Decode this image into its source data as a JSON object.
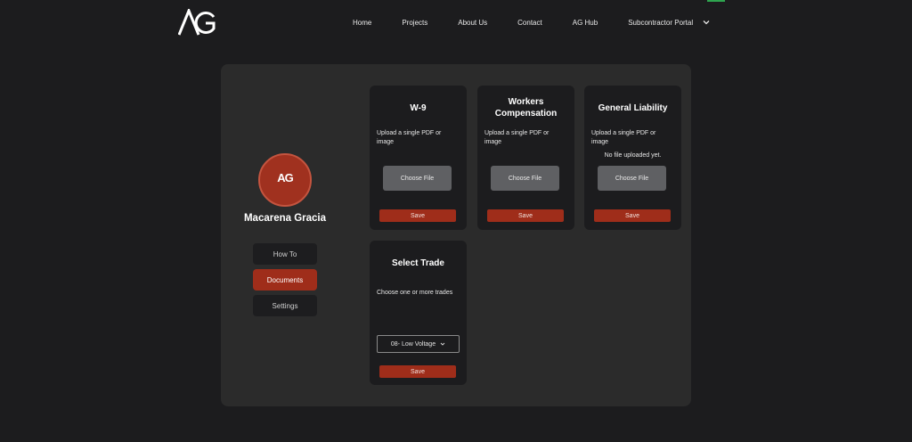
{
  "header": {
    "logo_text": "AG",
    "nav": [
      {
        "label": "Home"
      },
      {
        "label": "Projects"
      },
      {
        "label": "About Us"
      },
      {
        "label": "Contact"
      },
      {
        "label": "AG Hub"
      },
      {
        "label": "Subcontractor Portal"
      }
    ],
    "dropdown_icon": "chevron-down-icon"
  },
  "profile": {
    "avatar_text": "AG",
    "name": "Macarena Gracia",
    "menu": [
      {
        "label": "How To",
        "active": false
      },
      {
        "label": "Documents",
        "active": true
      },
      {
        "label": "Settings",
        "active": false
      }
    ]
  },
  "cards": {
    "w9": {
      "title": "W-9",
      "hint": "Upload a single PDF or image",
      "file_button": "Choose File",
      "save": "Save"
    },
    "workers_comp": {
      "title_line1": "Workers",
      "title_line2": "Compensation",
      "hint": "Upload a single PDF or image",
      "file_button": "Choose File",
      "save": "Save"
    },
    "general_liability": {
      "title": "General Liability",
      "hint": "Upload a single PDF or image",
      "status": "No file uploaded yet.",
      "file_button": "Choose File",
      "save": "Save"
    },
    "select_trade": {
      "title": "Select Trade",
      "hint": "Choose one or more trades",
      "selected": "08- Low Voltage",
      "save": "Save"
    }
  },
  "colors": {
    "background": "#1c1c1e",
    "panel": "#2b2b2b",
    "accent": "#9f2d1a",
    "file_button": "#5f6063"
  }
}
